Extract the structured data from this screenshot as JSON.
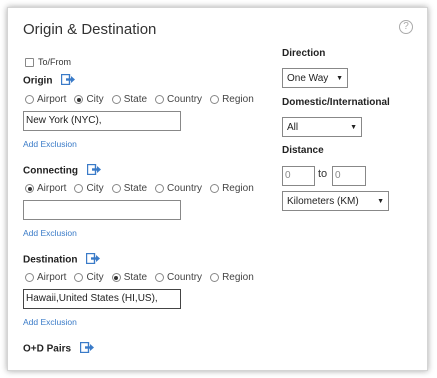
{
  "title": "Origin & Destination",
  "help_icon_glyph": "?",
  "to_from_label": "To/From",
  "radio_options": [
    "Airport",
    "City",
    "State",
    "Country",
    "Region"
  ],
  "origin": {
    "label": "Origin",
    "selected": "City",
    "value": "New York (NYC),",
    "add_exclusion": "Add Exclusion"
  },
  "connecting": {
    "label": "Connecting",
    "selected": "Airport",
    "value": "",
    "add_exclusion": "Add Exclusion"
  },
  "destination": {
    "label": "Destination",
    "selected": "State",
    "value": "Hawaii,United States (HI,US),",
    "add_exclusion": "Add Exclusion"
  },
  "od_pairs_label": "O+D Pairs",
  "direction": {
    "label": "Direction",
    "value": "One Way"
  },
  "domestic_international": {
    "label": "Domestic/International",
    "value": "All"
  },
  "distance": {
    "label": "Distance",
    "from": "0",
    "to_label": "to",
    "to": "0",
    "unit": "Kilometers (KM)"
  },
  "colors": {
    "link": "#3a7bc8",
    "icon": "#3a7bc8"
  }
}
